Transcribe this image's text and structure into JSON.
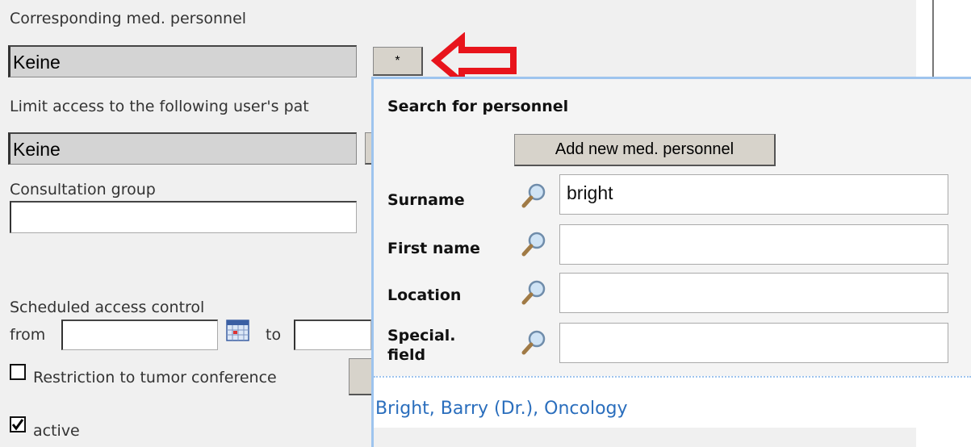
{
  "form": {
    "corresponding_label": "Corresponding med. personnel",
    "corresponding_value": "Keine",
    "select_button_label": "*",
    "limit_label": "Limit access to the following user's pat",
    "limit_value": "Keine",
    "consultation_label": "Consultation group",
    "consultation_value": "",
    "scheduled_label": "Scheduled access control",
    "from_label": "from",
    "to_label": "to",
    "from_value": "",
    "to_value": "",
    "restriction_label": "Restriction to tumor conference",
    "restriction_checked": false,
    "active_label": "active",
    "active_checked": true
  },
  "annotation": {
    "arrow_color": "#e8141c"
  },
  "popup": {
    "title": "Search for personnel",
    "add_button": "Add new med. personnel",
    "fields": {
      "surname": {
        "label": "Surname",
        "value": "bright"
      },
      "first_name": {
        "label": "First name",
        "value": ""
      },
      "location": {
        "label": "Location",
        "value": ""
      },
      "special_field": {
        "label_line1": "Special.",
        "label_line2": "field",
        "value": ""
      }
    },
    "results": [
      "Bright, Barry (Dr.), Oncology"
    ]
  }
}
